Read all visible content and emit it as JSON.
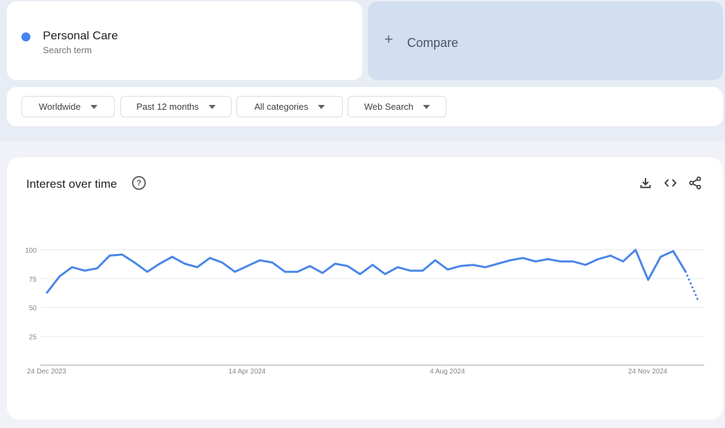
{
  "search_term": {
    "name": "Personal Care",
    "subtitle": "Search term",
    "color": "#4285f4"
  },
  "compare": {
    "icon": "plus-icon",
    "label": "Compare",
    "background": "#d1dff0"
  },
  "filters": [
    {
      "label": "Worldwide"
    },
    {
      "label": "Past 12 months"
    },
    {
      "label": "All categories"
    },
    {
      "label": "Web Search"
    }
  ],
  "chart_card": {
    "title": "Interest over time",
    "help_icon": "help-circle-icon",
    "actions": [
      {
        "name": "download-icon"
      },
      {
        "name": "embed-code-icon"
      },
      {
        "name": "share-icon"
      }
    ]
  },
  "chart_data": {
    "type": "line",
    "title": "Interest over time",
    "xlabel": "",
    "ylabel": "",
    "ylim": [
      0,
      100
    ],
    "yticks": [
      25,
      50,
      75,
      100
    ],
    "grid": true,
    "line_color": "#4a86e8",
    "x_tick_labels": [
      {
        "label": "24 Dec 2023",
        "index": 0
      },
      {
        "label": "14 Apr 2024",
        "index": 16
      },
      {
        "label": "4 Aug 2024",
        "index": 32
      },
      {
        "label": "24 Nov 2024",
        "index": 48
      }
    ],
    "series": [
      {
        "name": "Personal Care",
        "start_week": "24 Dec 2023",
        "interval": "weekly",
        "values": [
          63,
          77,
          85,
          82,
          84,
          95,
          96,
          89,
          81,
          88,
          94,
          88,
          85,
          93,
          89,
          81,
          86,
          91,
          89,
          81,
          81,
          86,
          80,
          88,
          86,
          79,
          87,
          79,
          85,
          82,
          82,
          91,
          83,
          86,
          87,
          85,
          88,
          91,
          93,
          90,
          92,
          90,
          90,
          87,
          92,
          95,
          90,
          100,
          74,
          94,
          99,
          81,
          56
        ],
        "partial_last_point": true
      }
    ]
  }
}
